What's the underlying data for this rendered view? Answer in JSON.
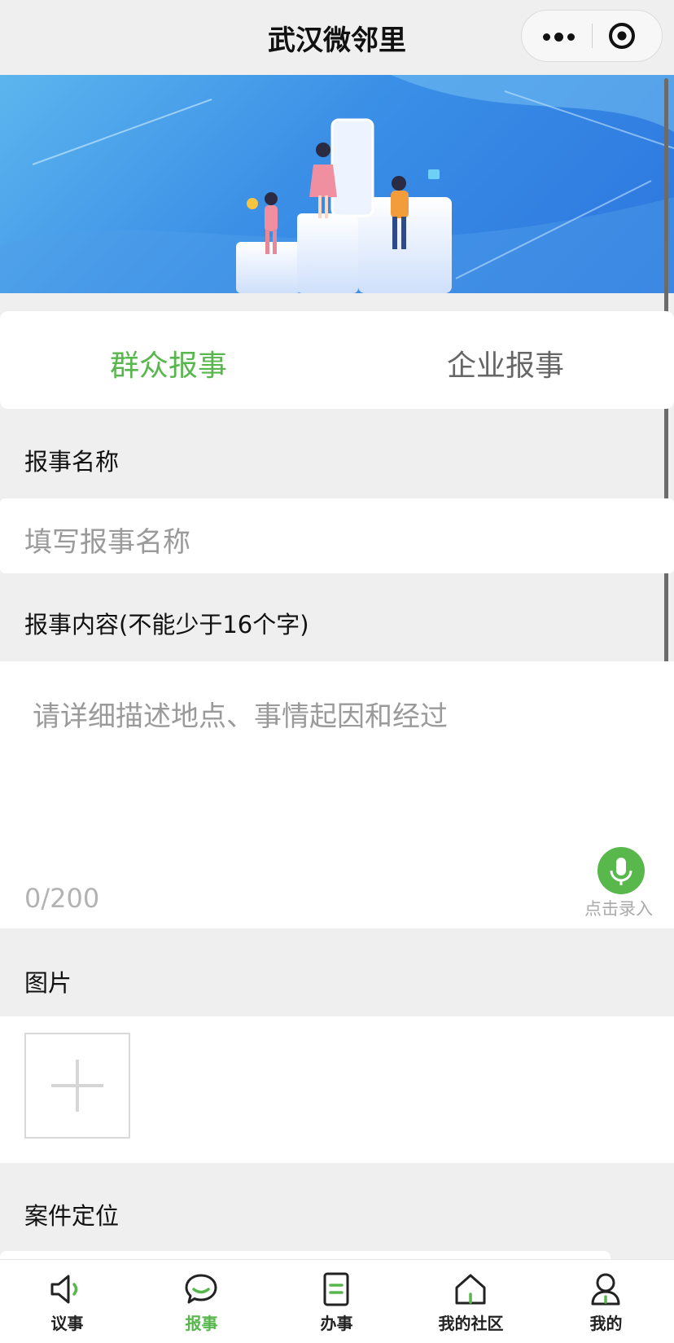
{
  "navbar": {
    "title": "武汉微邻里"
  },
  "tabs": [
    {
      "label": "群众报事",
      "active": true
    },
    {
      "label": "企业报事",
      "active": false
    }
  ],
  "form": {
    "name_label": "报事名称",
    "name_placeholder": "填写报事名称",
    "content_label": "报事内容(不能少于16个字)",
    "content_placeholder": "请详细描述地点、事情起因和经过",
    "content_counter": "0/200",
    "voice_label": "点击录入",
    "image_label": "图片",
    "location_label": "案件定位"
  },
  "tabbar": [
    {
      "label": "议事",
      "icon": "speaker-icon",
      "active": false
    },
    {
      "label": "报事",
      "icon": "chat-bubble-icon",
      "active": true
    },
    {
      "label": "办事",
      "icon": "document-icon",
      "active": false
    },
    {
      "label": "我的社区",
      "icon": "home-icon",
      "active": false
    },
    {
      "label": "我的",
      "icon": "person-icon",
      "active": false
    }
  ],
  "colors": {
    "accent": "#58b74c",
    "background": "#efefef",
    "banner_blue": "#3a8fe6"
  }
}
